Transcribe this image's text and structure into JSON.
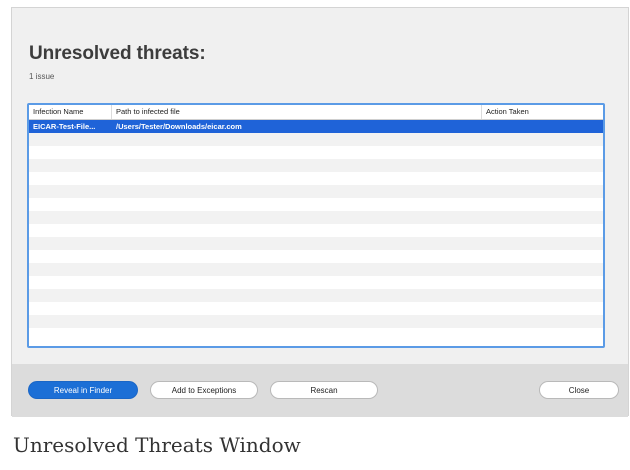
{
  "window": {
    "title": "Unresolved threats:",
    "subtitle": "1 issue"
  },
  "table": {
    "columns": [
      "Infection Name",
      "Path to infected file",
      "Action Taken"
    ],
    "rows": [
      {
        "name": "EICAR-Test-File...",
        "path": "/Users/Tester/Downloads/eicar.com",
        "action": "",
        "selected": true
      }
    ],
    "empty_rows": 15
  },
  "buttons": {
    "reveal": "Reveal in Finder",
    "exceptions": "Add to Exceptions",
    "rescan": "Rescan",
    "close": "Close"
  },
  "caption": "Unresolved Threats Window",
  "colors": {
    "accent": "#1c6fd6",
    "selection": "#1f63d8",
    "table_border": "#5b9be6"
  }
}
